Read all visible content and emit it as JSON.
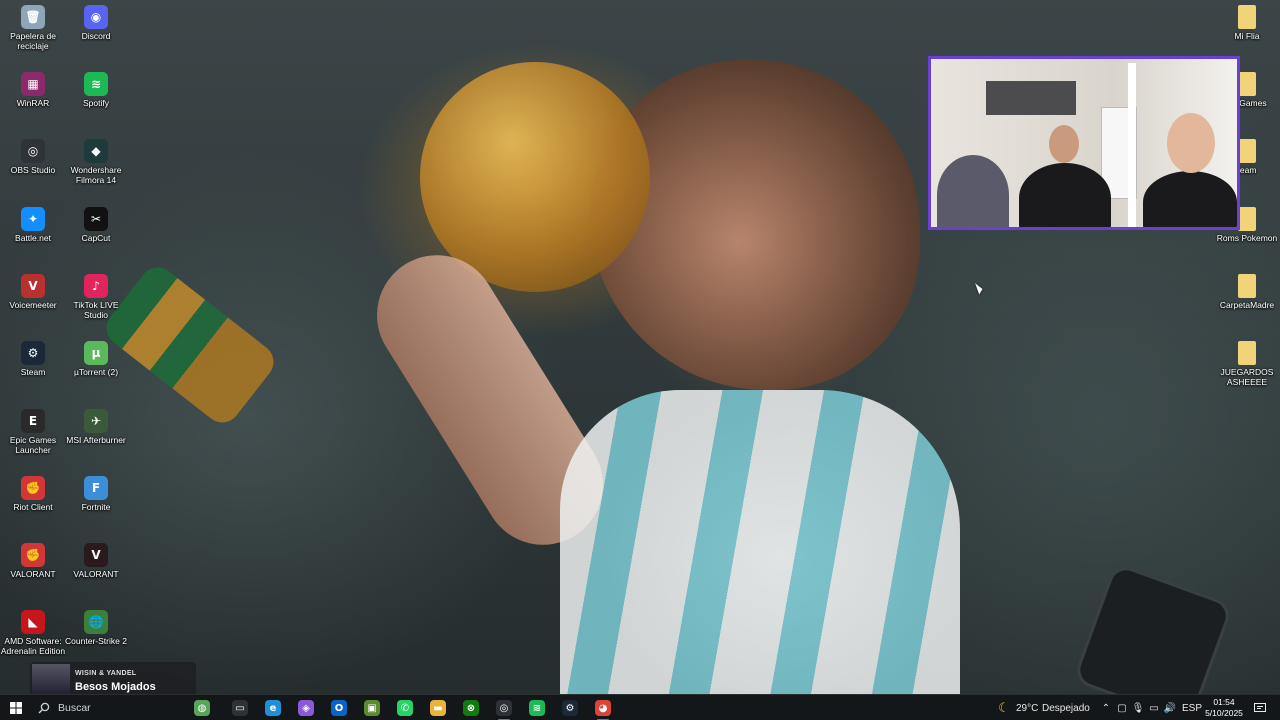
{
  "colors": {
    "taskbar_bg": "#141719",
    "cam_border": "#6a3fd6",
    "active_indicator": "#e24a4a"
  },
  "desktop_icons_left": [
    {
      "label": "Papelera de reciclaje",
      "icon": "recycle-bin-icon",
      "color": "#8fa6b8",
      "glyph": "🗑"
    },
    {
      "label": "Discord",
      "icon": "discord-icon",
      "color": "#5865f2",
      "glyph": "◉"
    },
    {
      "label": "WinRAR",
      "icon": "winrar-icon",
      "color": "#8b2a6a",
      "glyph": "▦"
    },
    {
      "label": "Spotify",
      "icon": "spotify-icon",
      "color": "#1db954",
      "glyph": "≋"
    },
    {
      "label": "OBS Studio",
      "icon": "obs-icon",
      "color": "#30323a",
      "glyph": "◎"
    },
    {
      "label": "Wondershare Filmora 14",
      "icon": "filmora-icon",
      "color": "#1f3a3a",
      "glyph": "◆"
    },
    {
      "label": "Battle.net",
      "icon": "battlenet-icon",
      "color": "#148eff",
      "glyph": "✦"
    },
    {
      "label": "CapCut",
      "icon": "capcut-icon",
      "color": "#111111",
      "glyph": "✂"
    },
    {
      "label": "Voicemeeter",
      "icon": "voicemeeter-icon",
      "color": "#b8312f",
      "glyph": "V"
    },
    {
      "label": "TikTok LIVE Studio",
      "icon": "tiktok-live-icon",
      "color": "#e0245e",
      "glyph": "♪"
    },
    {
      "label": "Steam",
      "icon": "steam-icon",
      "color": "#1b2838",
      "glyph": "⚙"
    },
    {
      "label": "µTorrent (2)",
      "icon": "utorrent-icon",
      "color": "#5cb85c",
      "glyph": "µ"
    },
    {
      "label": "Epic Games Launcher",
      "icon": "epic-games-icon",
      "color": "#2a2a2a",
      "glyph": "E"
    },
    {
      "label": "MSI Afterburner",
      "icon": "msi-afterburner-icon",
      "color": "#3a5a3a",
      "glyph": "✈"
    },
    {
      "label": "Riot Client",
      "icon": "riot-client-icon",
      "color": "#d13639",
      "glyph": "✊"
    },
    {
      "label": "Fortnite",
      "icon": "fortnite-icon",
      "color": "#3a8fd8",
      "glyph": "F"
    },
    {
      "label": "VALORANT",
      "icon": "riot-valorant-icon",
      "color": "#d13639",
      "glyph": "✊"
    },
    {
      "label": "VALORANT",
      "icon": "valorant-icon",
      "color": "#2a1a1e",
      "glyph": "V"
    },
    {
      "label": "AMD Software: Adrenalin Edition",
      "icon": "amd-icon",
      "color": "#c4161c",
      "glyph": "◣"
    },
    {
      "label": "Counter-Strike 2",
      "icon": "counter-strike-icon",
      "color": "#3d7f3d",
      "glyph": "🌐"
    }
  ],
  "desktop_icons_right": [
    {
      "label": "Mi Flia",
      "icon": "folder-icon",
      "color": "#f1d37a",
      "glyph": ""
    },
    {
      "label": "de Games",
      "icon": "folder-icon",
      "color": "#f1d37a",
      "glyph": ""
    },
    {
      "label": "team",
      "icon": "folder-icon",
      "color": "#f1d37a",
      "glyph": ""
    },
    {
      "label": "Roms Pokemon",
      "icon": "folder-icon",
      "color": "#f1d37a",
      "glyph": ""
    },
    {
      "label": "CarpetaMadre",
      "icon": "folder-icon",
      "color": "#f1d37a",
      "glyph": ""
    },
    {
      "label": "JUEGARDOS ASHEEEE",
      "icon": "folder-icon",
      "color": "#f1d37a",
      "glyph": ""
    }
  ],
  "media": {
    "artist": "WISIN & YANDEL",
    "title": "Besos Mojados"
  },
  "taskbar": {
    "search_label": "Buscar",
    "apps": [
      {
        "name": "taskbar-widget-icon",
        "color": "#5aa35a",
        "glyph": "◍"
      },
      {
        "name": "task-view-icon",
        "color": "#2e3236",
        "glyph": "▭"
      },
      {
        "name": "edge-icon",
        "color": "#1f8fd8",
        "glyph": "e"
      },
      {
        "name": "copilot-icon",
        "color": "#8a5ad8",
        "glyph": "◈"
      },
      {
        "name": "outlook-icon",
        "color": "#0a64c8",
        "glyph": "O"
      },
      {
        "name": "minecraft-icon",
        "color": "#5d8a2f",
        "glyph": "▣"
      },
      {
        "name": "whatsapp-icon",
        "color": "#25d366",
        "glyph": "✆"
      },
      {
        "name": "file-explorer-icon",
        "color": "#e8b33a",
        "glyph": "▬"
      },
      {
        "name": "xbox-icon",
        "color": "#107c10",
        "glyph": "⊗"
      },
      {
        "name": "obs-taskbar-icon",
        "color": "#30323a",
        "glyph": "◎"
      },
      {
        "name": "spotify-taskbar-icon",
        "color": "#1db954",
        "glyph": "≋"
      },
      {
        "name": "steam-taskbar-icon",
        "color": "#1b2838",
        "glyph": "⚙"
      },
      {
        "name": "chrome-icon",
        "color": "#db4437",
        "glyph": "◕"
      }
    ],
    "weather_temp": "29°C",
    "weather_desc": "Despejado",
    "language": "ESP",
    "time": "01:54",
    "date": "5/10/2025"
  }
}
